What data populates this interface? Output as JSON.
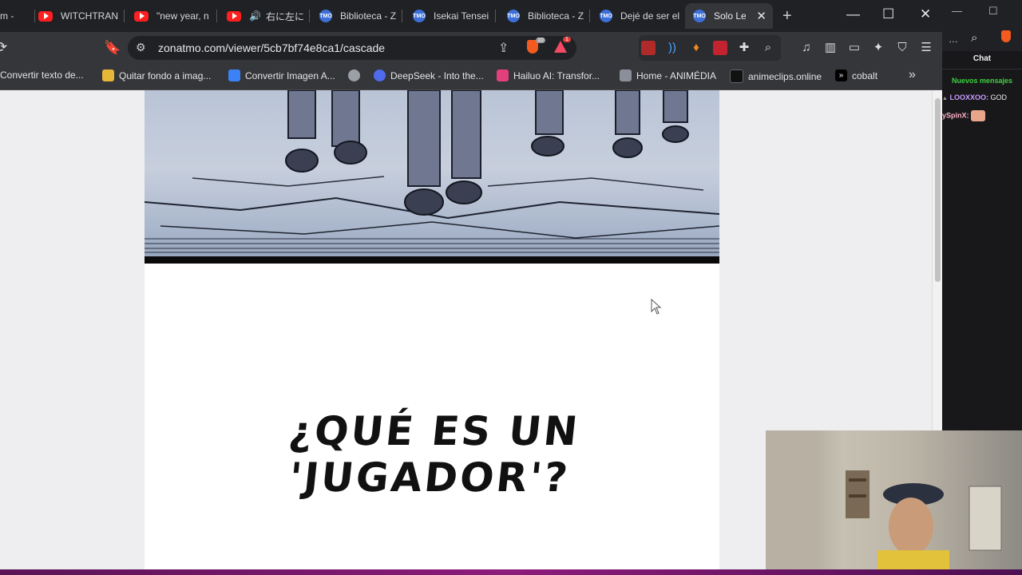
{
  "tabs": [
    {
      "title": "m -",
      "icon": "page-icon",
      "active": false
    },
    {
      "title": "WITCHTRAN",
      "icon": "youtube-icon",
      "active": false
    },
    {
      "title": "\"new year, n",
      "icon": "youtube-icon",
      "active": false
    },
    {
      "title": "右に左に",
      "icon": "youtube-icon",
      "active": false,
      "audio": true
    },
    {
      "title": "Biblioteca - Z",
      "icon": "tmo-icon",
      "active": false
    },
    {
      "title": "Isekai Tensei",
      "icon": "tmo-icon",
      "active": false
    },
    {
      "title": "Biblioteca - Z",
      "icon": "tmo-icon",
      "active": false
    },
    {
      "title": "Dejé de ser el",
      "icon": "tmo-icon",
      "active": false
    },
    {
      "title": "Solo Lev",
      "icon": "tmo-icon",
      "active": true
    }
  ],
  "tab_close": "✕",
  "new_tab": "+",
  "window_controls": {
    "minimize": "—",
    "maximize": "☐",
    "close": "✕"
  },
  "address_bar": {
    "url": "zonatmo.com/viewer/5cb7bf74e8ca1/cascade"
  },
  "brave_shield_count": "10",
  "rewards_count": "1",
  "bookmarks": [
    {
      "label": "Convertir texto de...",
      "color": "#d93025"
    },
    {
      "label": "Quitar fondo a imag...",
      "color": "#e8b737"
    },
    {
      "label": "Convertir Imagen A...",
      "color": "#3b82f6"
    },
    {
      "label": "",
      "color": "#9aa0a6"
    },
    {
      "label": "DeepSeek - Into the...",
      "color": "#4f6bed"
    },
    {
      "label": "Hailuo AI: Transfor...",
      "color": "#e2407c"
    },
    {
      "label": "Home - ANIMÉDIA",
      "color": "#8a8f99"
    },
    {
      "label": "animeclips.online",
      "color": "#111111"
    },
    {
      "label": "cobalt",
      "color": "#000000"
    }
  ],
  "page": {
    "manga_text_line1": "¿QUÉ ES UN",
    "manga_text_line2": "'JUGADOR'?"
  },
  "chat": {
    "title": "Chat",
    "new_messages": "Nuevos mensajes",
    "messages": [
      {
        "user": "LOOXXOO:",
        "text": "GOD",
        "user_color": "#c89bff"
      },
      {
        "user": "ySpinX:",
        "text": "",
        "user_color": "#ffb3c9"
      }
    ]
  }
}
